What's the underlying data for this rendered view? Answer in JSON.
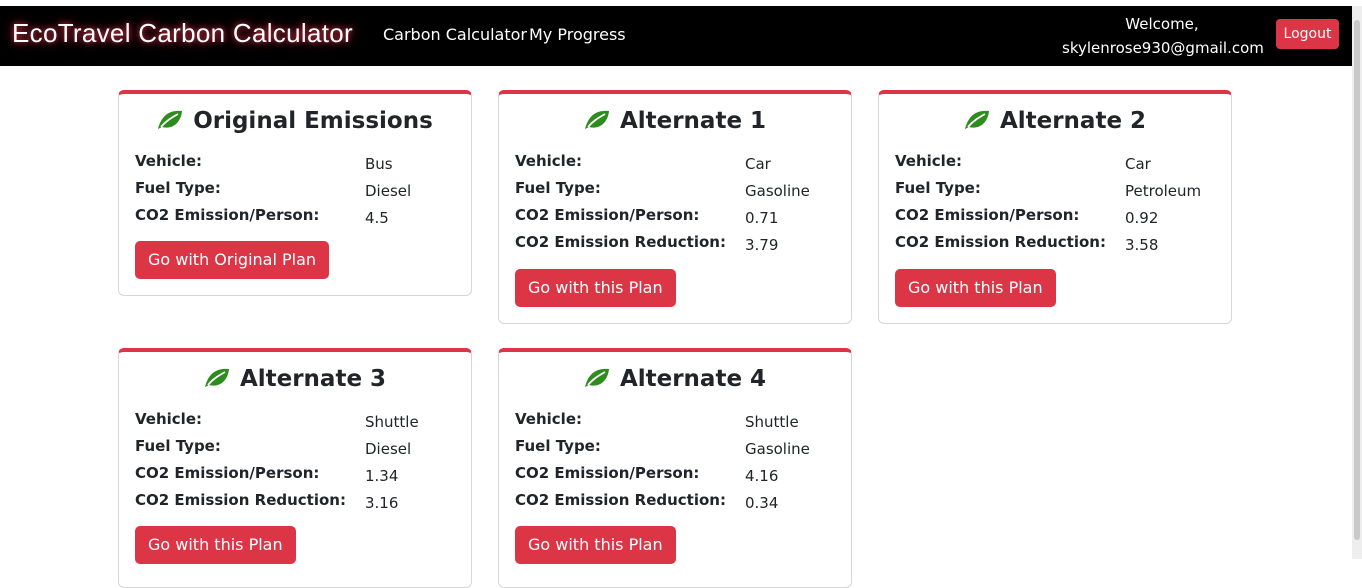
{
  "navbar": {
    "brand": "EcoTravel Carbon Calculator",
    "links": [
      "Carbon Calculator",
      "My Progress"
    ],
    "welcome_line1": "Welcome,",
    "welcome_email": "skylenrose930@gmail.com",
    "logout_label": "Logout"
  },
  "labels": {
    "vehicle": "Vehicle:",
    "fuel_type": "Fuel Type:",
    "co2_person": "CO2 Emission/Person:",
    "co2_reduction": "CO2 Emission Reduction:"
  },
  "colors": {
    "accent": "#dc3545",
    "leaf": "#2e8b1e",
    "navbar": "#000000"
  },
  "cards": [
    {
      "title": "Original Emissions",
      "vehicle": "Bus",
      "fuel_type": "Diesel",
      "co2_person": "4.5",
      "button": "Go with Original Plan"
    },
    {
      "title": "Alternate 1",
      "vehicle": "Car",
      "fuel_type": "Gasoline",
      "co2_person": "0.71",
      "co2_reduction": "3.79",
      "button": "Go with this Plan"
    },
    {
      "title": "Alternate 2",
      "vehicle": "Car",
      "fuel_type": "Petroleum",
      "co2_person": "0.92",
      "co2_reduction": "3.58",
      "button": "Go with this Plan"
    },
    {
      "title": "Alternate 3",
      "vehicle": "Shuttle",
      "fuel_type": "Diesel",
      "co2_person": "1.34",
      "co2_reduction": "3.16",
      "button": "Go with this Plan"
    },
    {
      "title": "Alternate 4",
      "vehicle": "Shuttle",
      "fuel_type": "Gasoline",
      "co2_person": "4.16",
      "co2_reduction": "0.34",
      "button": "Go with this Plan"
    }
  ]
}
